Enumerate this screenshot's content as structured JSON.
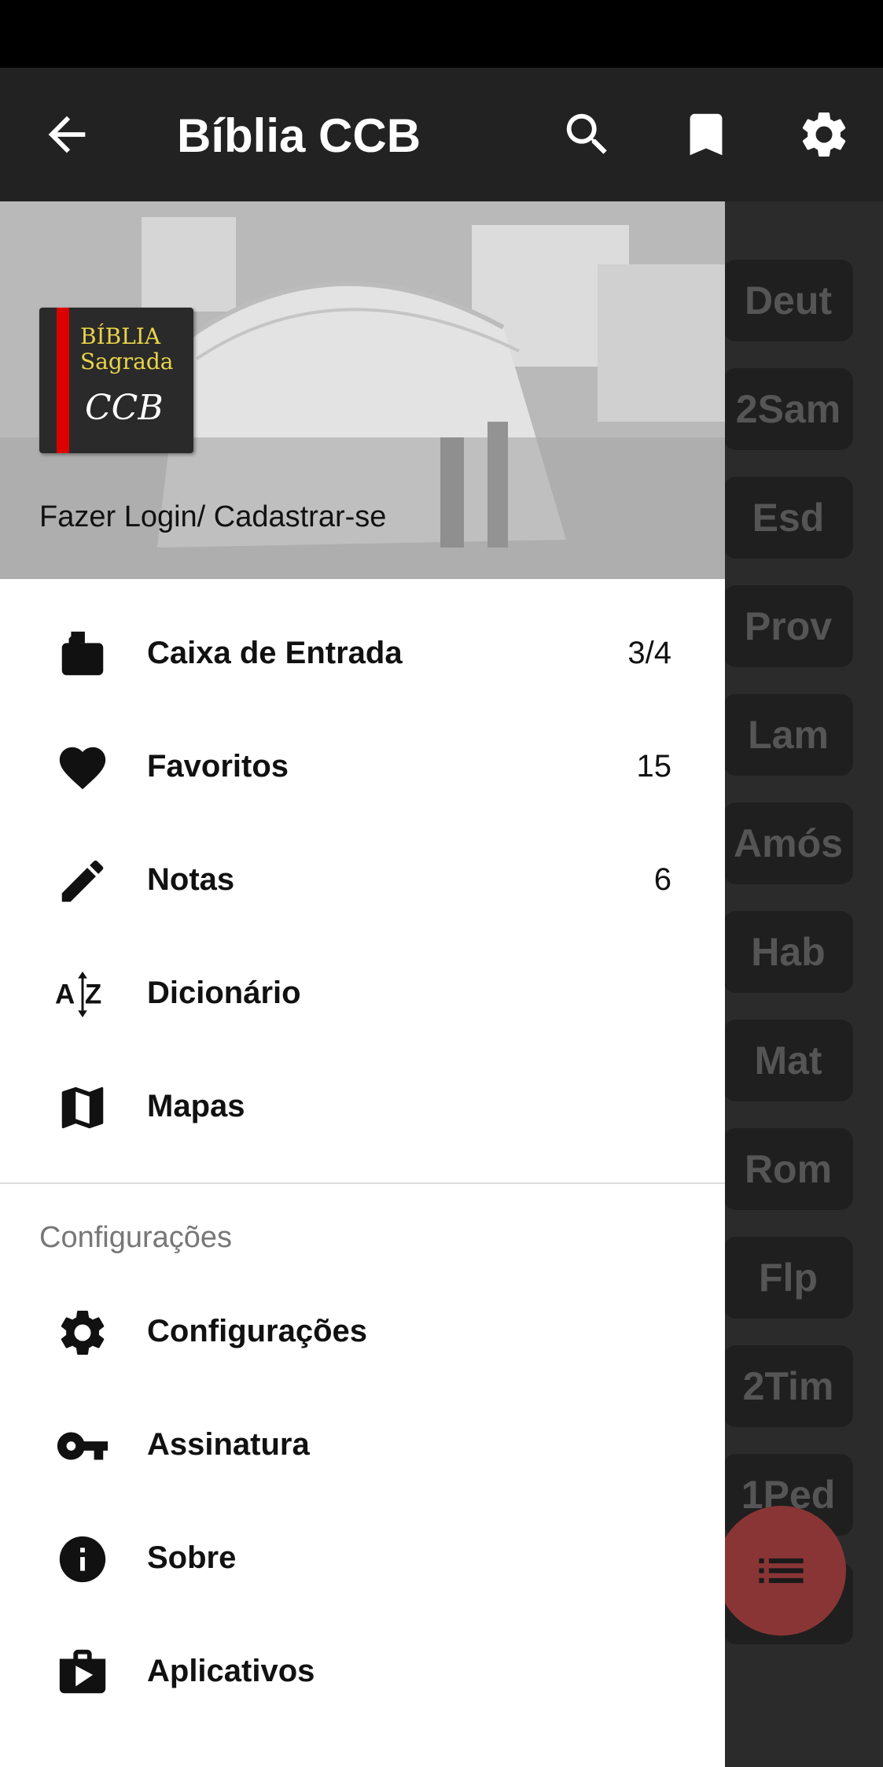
{
  "app": {
    "title": "Bíblia CCB"
  },
  "appbar": {
    "back_icon": "arrow-back-icon",
    "actions": [
      "search-icon",
      "bookmark-icon",
      "gear-icon"
    ]
  },
  "books": [
    "Deut",
    "2Sam",
    "Esd",
    "Prov",
    "Lam",
    "Amós",
    "Hab",
    "Mat",
    "Rom",
    "Flp",
    "2Tim",
    "1Ped"
  ],
  "drawer": {
    "logo": {
      "line1": "BÍBLIA",
      "line2": "Sagrada",
      "line3": "CCB"
    },
    "login_label": "Fazer Login/ Cadastrar-se",
    "items": [
      {
        "label": "Caixa de Entrada",
        "count": "3/4",
        "icon": "inbox-icon"
      },
      {
        "label": "Favoritos",
        "count": "15",
        "icon": "heart-icon"
      },
      {
        "label": "Notas",
        "count": "6",
        "icon": "pencil-icon"
      },
      {
        "label": "Dicionário",
        "count": "",
        "icon": "sort-az-icon"
      },
      {
        "label": "Mapas",
        "count": "",
        "icon": "map-icon"
      }
    ],
    "section_title": "Configurações",
    "settings_items": [
      {
        "label": "Configurações",
        "icon": "gear-icon"
      },
      {
        "label": "Assinatura",
        "icon": "key-icon"
      },
      {
        "label": "Sobre",
        "icon": "info-icon"
      },
      {
        "label": "Aplicativos",
        "icon": "shop-bag-icon"
      }
    ]
  },
  "fab": {
    "icon": "list-icon",
    "color": "#8a3535"
  },
  "colors": {
    "appbar": "#222222",
    "background": "#2b2b2b",
    "drawer": "#ffffff"
  }
}
